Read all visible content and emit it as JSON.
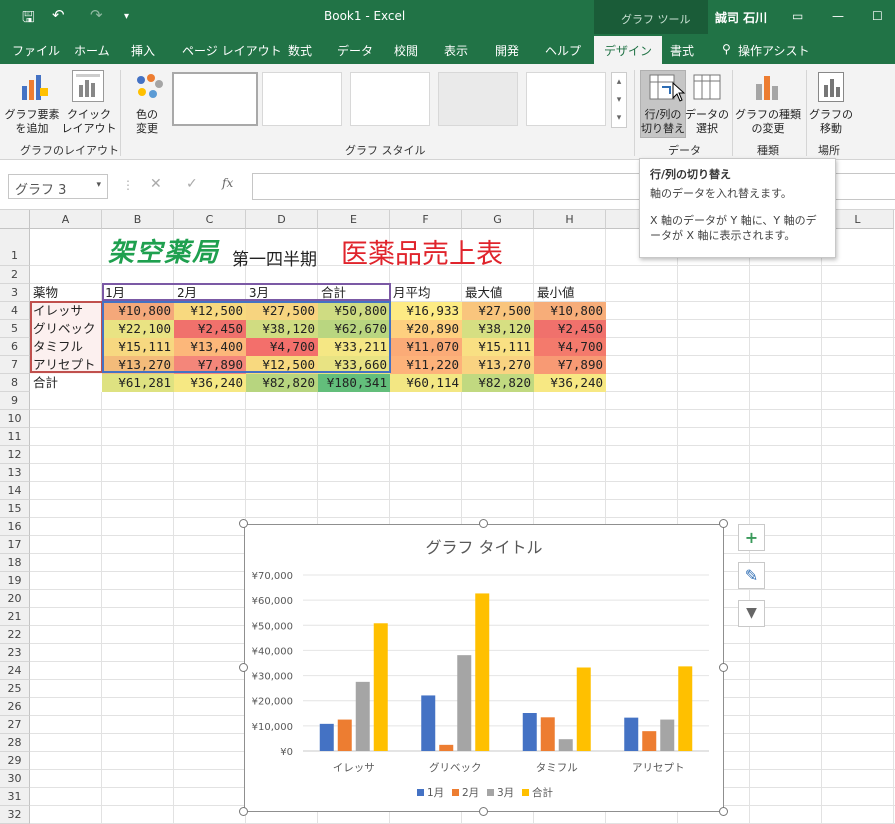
{
  "titlebar": {
    "doc_title": "Book1  -  Excel",
    "context_label": "グラフ ツール",
    "user": "誠司 石川"
  },
  "tabs": [
    "ファイル",
    "ホーム",
    "挿入",
    "ページ レイアウト",
    "数式",
    "データ",
    "校閲",
    "表示",
    "開発",
    "ヘルプ",
    "デザイン",
    "書式",
    "操作アシスト"
  ],
  "ribbon": {
    "add_element": "グラフ要素\nを追加",
    "quick_layout": "クイック\nレイアウト",
    "change_colors": "色の\n変更",
    "group_layout": "グラフのレイアウト",
    "group_styles": "グラフ スタイル",
    "switch_rowcol": "行/列の\n切り替え",
    "select_data": "データの\n選択",
    "group_data": "データ",
    "change_type": "グラフの種類\nの変更",
    "group_type": "種類",
    "move_chart": "グラフの\n移動",
    "group_location": "場所"
  },
  "formula_bar": {
    "name_box": "グラフ 3",
    "fx": "fx"
  },
  "tooltip": {
    "title": "行/列の切り替え",
    "line1": "軸のデータを入れ替えます。",
    "line2": "X 軸のデータが Y 軸に、Y 軸のデータが X 軸に表示されます。"
  },
  "columns": [
    "A",
    "B",
    "C",
    "D",
    "E",
    "F",
    "G",
    "H",
    "I",
    "J",
    "K",
    "L"
  ],
  "rows": [
    "1",
    "2",
    "3",
    "4",
    "5",
    "6",
    "7",
    "8",
    "9",
    "10",
    "11",
    "12",
    "13",
    "14",
    "15",
    "16",
    "17",
    "18",
    "19",
    "20",
    "21",
    "22",
    "23",
    "24",
    "25",
    "26",
    "27",
    "28",
    "29",
    "30",
    "31",
    "32"
  ],
  "sheet": {
    "title_a": "架空薬局",
    "title_b": "第一四半期",
    "title_c": "医薬品売上表",
    "headers": [
      "薬物",
      "1月",
      "2月",
      "3月",
      "合計",
      "月平均",
      "最大値",
      "最小値"
    ],
    "body": [
      [
        "イレッサ",
        "¥10,800",
        "¥12,500",
        "¥27,500",
        "¥50,800",
        "¥16,933",
        "¥27,500",
        "¥10,800"
      ],
      [
        "グリベック",
        "¥22,100",
        "¥2,450",
        "¥38,120",
        "¥62,670",
        "¥20,890",
        "¥38,120",
        "¥2,450"
      ],
      [
        "タミフル",
        "¥15,111",
        "¥13,400",
        "¥4,700",
        "¥33,211",
        "¥11,070",
        "¥15,111",
        "¥4,700"
      ],
      [
        "アリセプト",
        "¥13,270",
        "¥7,890",
        "¥12,500",
        "¥33,660",
        "¥11,220",
        "¥13,270",
        "¥7,890"
      ],
      [
        "合計",
        "¥61,281",
        "¥36,240",
        "¥82,820",
        "¥180,341",
        "¥60,114",
        "¥82,820",
        "¥36,240"
      ]
    ]
  },
  "colors": {
    "excel_green": "#217346",
    "s1": "#4472c4",
    "s2": "#ed7d31",
    "s3": "#a5a5a5",
    "s4": "#ffc000"
  },
  "chart_data": {
    "type": "bar",
    "title": "グラフ タイトル",
    "categories": [
      "イレッサ",
      "グリベック",
      "タミフル",
      "アリセプト"
    ],
    "series": [
      {
        "name": "1月",
        "values": [
          10800,
          22100,
          15111,
          13270
        ]
      },
      {
        "name": "2月",
        "values": [
          12500,
          2450,
          13400,
          7890
        ]
      },
      {
        "name": "3月",
        "values": [
          27500,
          38120,
          4700,
          12500
        ]
      },
      {
        "name": "合計",
        "values": [
          50800,
          62670,
          33211,
          33660
        ]
      }
    ],
    "ylim": [
      0,
      70000
    ],
    "yticks": [
      "¥0",
      "¥10,000",
      "¥20,000",
      "¥30,000",
      "¥40,000",
      "¥50,000",
      "¥60,000",
      "¥70,000"
    ],
    "legend": "bottom",
    "grid": true
  }
}
